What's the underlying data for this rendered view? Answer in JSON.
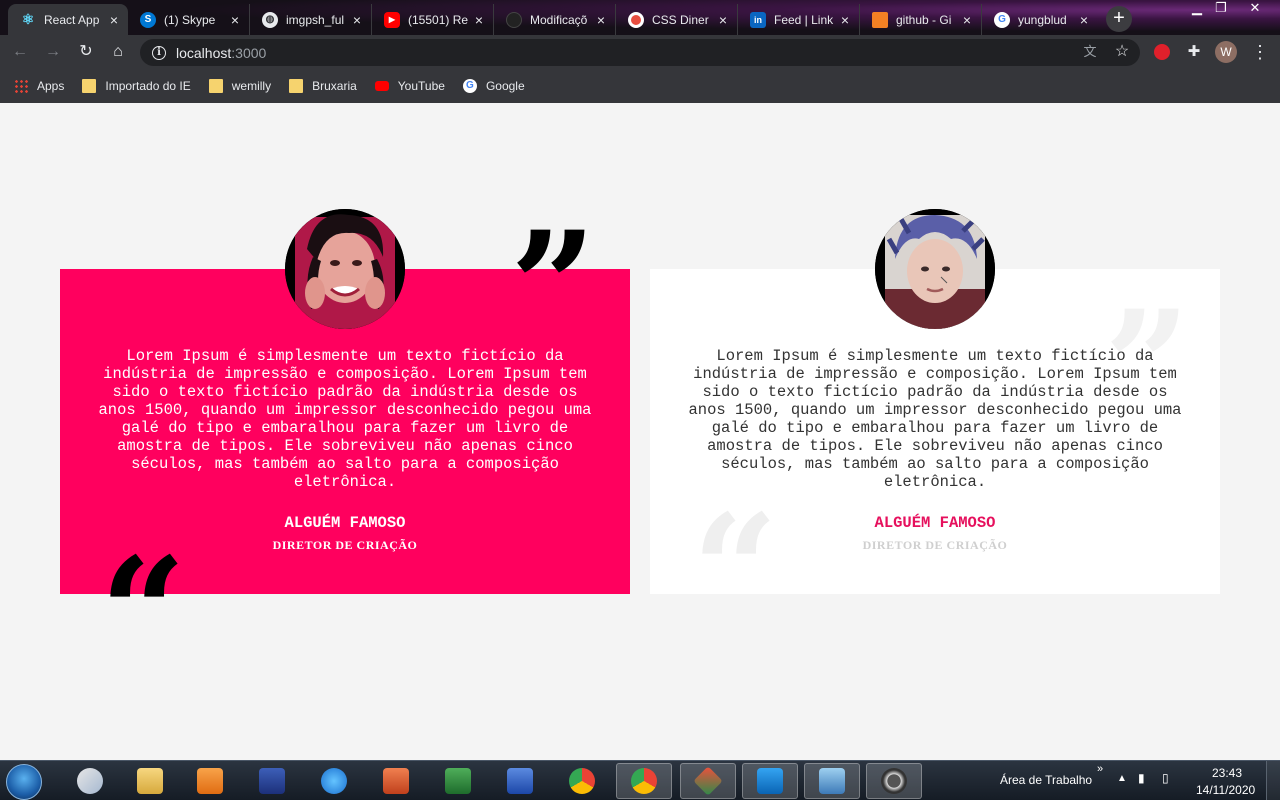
{
  "browser": {
    "tabs": [
      {
        "title": "React App",
        "icon": "react-icon",
        "color": "#61dafb"
      },
      {
        "title": "(1) Skype",
        "icon": "skype-icon",
        "color": "#0078d4"
      },
      {
        "title": "imgpsh_ful",
        "icon": "globe-icon",
        "color": "#e8eaed"
      },
      {
        "title": "(15501) Re",
        "icon": "youtube-icon",
        "color": "#ff0000"
      },
      {
        "title": "Modificaçõ",
        "icon": "github-icon",
        "color": "#222222"
      },
      {
        "title": "CSS Diner",
        "icon": "diner-icon",
        "color": "#e84e40"
      },
      {
        "title": "Feed | Link",
        "icon": "linkedin-icon",
        "color": "#0a66c2"
      },
      {
        "title": "github - Gi",
        "icon": "stackoverflow-icon",
        "color": "#f48024"
      },
      {
        "title": "yungblud",
        "icon": "google-icon",
        "color": "#4285f4"
      }
    ],
    "new_tab": "+",
    "url_host": "localhost",
    "url_port": ":3000",
    "profile_initial": "W",
    "bookmarks": [
      {
        "label": "Apps",
        "icon": "apps-grid-icon"
      },
      {
        "label": "Importado do IE",
        "icon": "folder-icon"
      },
      {
        "label": "wemilly",
        "icon": "folder-icon"
      },
      {
        "label": "Bruxaria",
        "icon": "folder-icon"
      },
      {
        "label": "YouTube",
        "icon": "youtube-icon"
      },
      {
        "label": "Google",
        "icon": "google-icon"
      }
    ]
  },
  "testimonials": [
    {
      "quote": "Lorem Ipsum é simplesmente um texto fictício da indústria de impressão e composição. Lorem Ipsum tem sido o texto fictício padrão da indústria desde os anos 1500, quando um impressor desconhecido pegou uma galé do tipo e embaralhou para fazer um livro de amostra de tipos. Ele sobreviveu não apenas cinco séculos, mas também ao salto para a composição eletrônica.",
      "name": "ALGUÉM FAMOSO",
      "role": "DIRETOR DE CRIAÇÃO",
      "background": "#ff005e"
    },
    {
      "quote": "Lorem Ipsum é simplesmente um texto fictício da indústria de impressão e composição. Lorem Ipsum tem sido o texto fictício padrão da indústria desde os anos 1500, quando um impressor desconhecido pegou uma galé do tipo e embaralhou para fazer um livro de amostra de tipos. Ele sobreviveu não apenas cinco séculos, mas também ao salto para a composição eletrônica.",
      "name": "ALGUÉM FAMOSO",
      "role": "DIRETOR DE CRIAÇÃO",
      "background": "#ffffff"
    }
  ],
  "taskbar": {
    "desktop_label": "Área de Trabalho",
    "time": "23:43",
    "date": "14/11/2020"
  }
}
